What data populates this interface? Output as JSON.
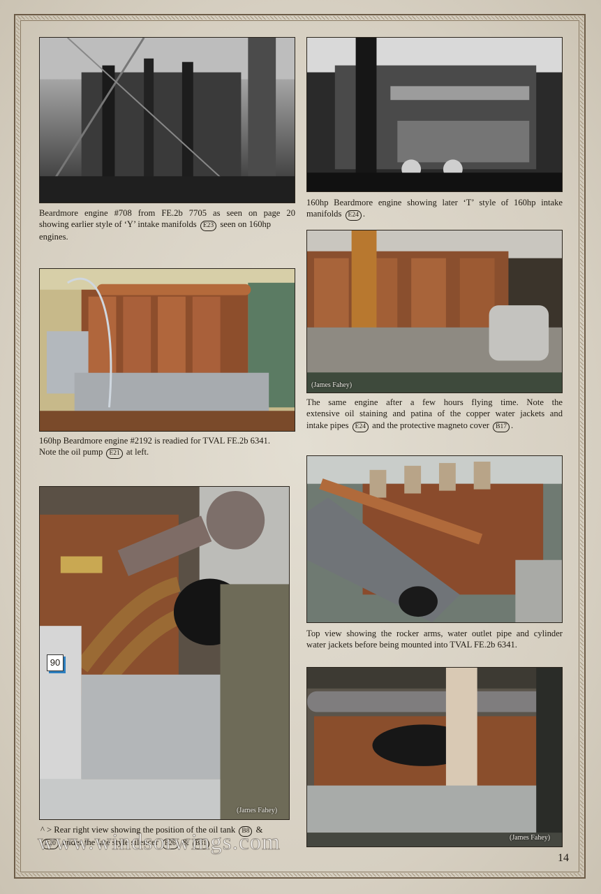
{
  "page": {
    "number": "14",
    "watermark": "www.windsorwings.com"
  },
  "photos": {
    "engine_708": {
      "alt": "Beardmore engine #708 on FE.2b 7705",
      "credit": ""
    },
    "t_style": {
      "alt": "Beardmore engine with later T style intake manifolds",
      "credit": ""
    },
    "after_flying": {
      "alt": "Engine after a few hours flying time",
      "credit": "(James Fahey)"
    },
    "engine_2192": {
      "alt": "160hp Beardmore engine #2192 readied for TVAL FE.2b 6341",
      "credit": ""
    },
    "top_view": {
      "alt": "Top view showing rocker arms and water outlet pipe",
      "credit": ""
    },
    "rear_right": {
      "alt": "Rear right view showing oil tank",
      "credit": "(James Fahey)",
      "callout": "90"
    },
    "silencer": {
      "alt": "Engine under late style silencer",
      "credit": "(James Fahey)"
    }
  },
  "captions": {
    "engine_708": {
      "l1": "Beardmore engine #708 from FE.2b 7705 as seen on page 20",
      "l2a": "showing earlier style of ‘Y’ intake manifolds",
      "ref1": "E23",
      "l2b": "seen on 160hp",
      "l3": "engines."
    },
    "t_style": {
      "l1": "160hp Beardmore engine showing later ‘T’ style of 160hp intake",
      "l2a": "manifolds",
      "ref1": "E24",
      "l2b": "."
    },
    "after_flying": {
      "l1": "The same engine after a few hours flying time. Note the",
      "l2": "extensive oil staining and patina of the copper water jackets and",
      "l3a": "intake pipes",
      "ref1": "E24",
      "l3b": "and the protective magneto cover",
      "ref2": "B17",
      "l3c": "."
    },
    "engine_2192": {
      "l1": "160hp Beardmore engine #2192 is readied for TVAL FE.2b 6341.",
      "l2a": "Note the oil pump",
      "ref1": "E21",
      "l2b": "at left."
    },
    "top_view": {
      "l1": "Top view showing the rocker arms, water outlet pipe and cylinder",
      "l2": "water jackets before being mounted into TVAL FE.2b 6341."
    },
    "rear_right": {
      "l1a": "^ > Rear right view showing the position of the oil tank",
      "ref1": "B8",
      "l1b": "&",
      "ref2": "B20",
      "l2a": "under the late style silencer",
      "ref3": "B26",
      "l2b": "&",
      "ref4": "B31"
    }
  }
}
